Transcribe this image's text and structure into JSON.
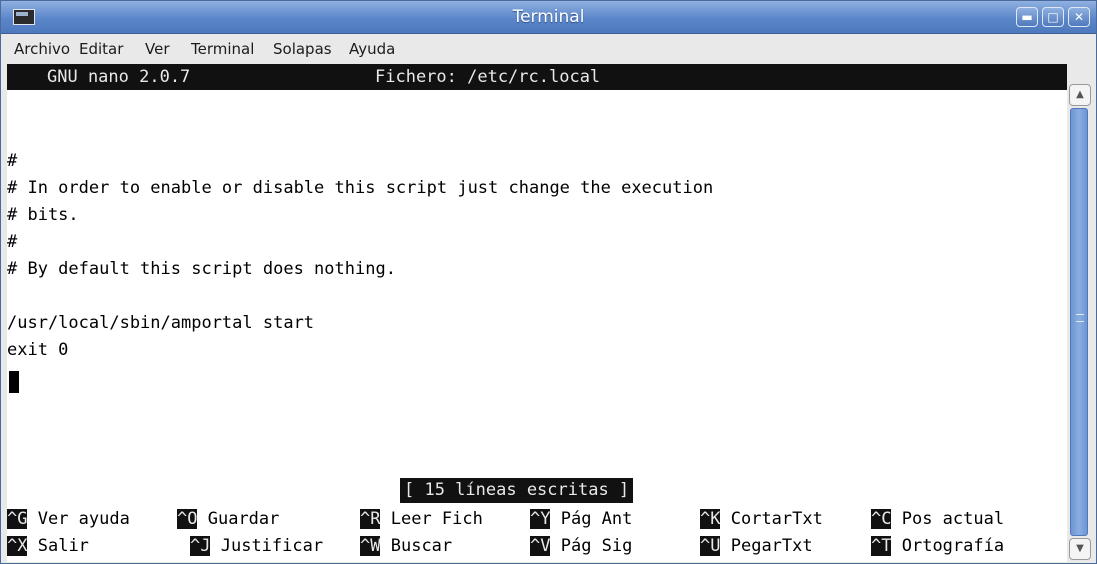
{
  "window": {
    "title": "Terminal",
    "controls": [
      "minimize-icon",
      "maximize-icon",
      "close-icon"
    ]
  },
  "menu": [
    "Archivo",
    "Editar",
    "Ver",
    "Terminal",
    "Solapas",
    "Ayuda"
  ],
  "nano": {
    "version": "GNU nano 2.0.7",
    "file": "Fichero: /etc/rc.local",
    "lines": [
      "#",
      "# In order to enable or disable this script just change the execution",
      "# bits.",
      "#",
      "# By default this script does nothing.",
      "",
      "/usr/local/sbin/amportal start",
      "exit 0"
    ],
    "status": "[ 15 líneas escritas ]",
    "shortcuts_row1": [
      {
        "key": "^G",
        "label": "Ver ayuda"
      },
      {
        "key": "^O",
        "label": "Guardar"
      },
      {
        "key": "^R",
        "label": "Leer Fich"
      },
      {
        "key": "^Y",
        "label": "Pág Ant"
      },
      {
        "key": "^K",
        "label": "CortarTxt"
      },
      {
        "key": "^C",
        "label": "Pos actual"
      }
    ],
    "shortcuts_row2": [
      {
        "key": "^X",
        "label": "Salir"
      },
      {
        "key": "^J",
        "label": "Justificar"
      },
      {
        "key": "^W",
        "label": "Buscar"
      },
      {
        "key": "^V",
        "label": "Pág Sig"
      },
      {
        "key": "^U",
        "label": "PegarTxt"
      },
      {
        "key": "^T",
        "label": "Ortografía"
      }
    ]
  },
  "colors": {
    "titlebar": "#5b86c9",
    "terminal_bg": "#ffffff",
    "inverse_bg": "#111111"
  }
}
